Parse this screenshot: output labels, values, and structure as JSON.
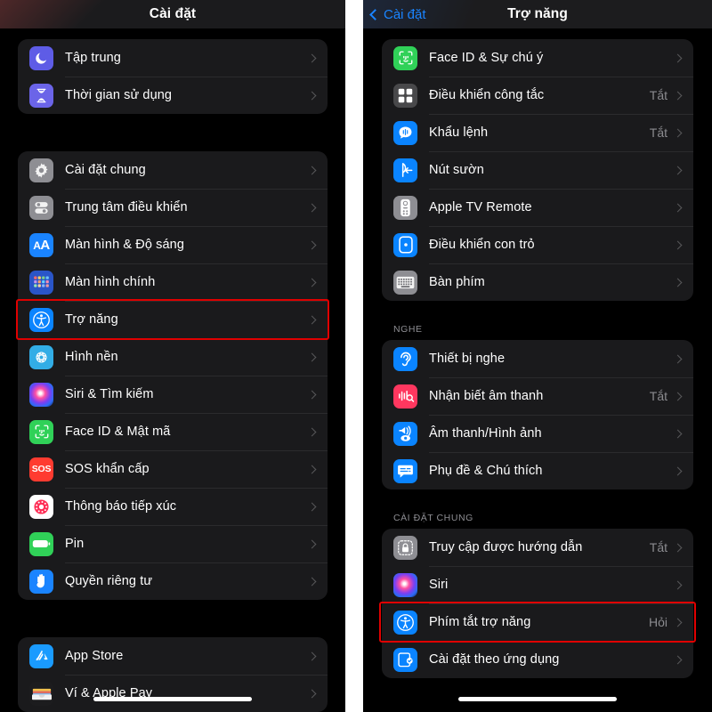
{
  "left_panel": {
    "nav": {
      "title": "Cài đặt"
    },
    "groups": [
      {
        "rows": [
          {
            "label": "Tập trung",
            "value": "",
            "icon": "moon-icon",
            "icon_bg": "#5e5ce6"
          },
          {
            "label": "Thời gian sử dụng",
            "value": "",
            "icon": "hourglass-icon",
            "icon_bg": "#6b64e8"
          }
        ]
      },
      {
        "rows": [
          {
            "label": "Cài đặt chung",
            "value": "",
            "icon": "gear-icon",
            "icon_bg": "#8e8e93"
          },
          {
            "label": "Trung tâm điều khiển",
            "value": "",
            "icon": "control-center-icon",
            "icon_bg": "#8e8e93"
          },
          {
            "label": "Màn hình & Độ sáng",
            "value": "",
            "icon": "display-brightness-icon",
            "icon_bg": "#1a84ff"
          },
          {
            "label": "Màn hình chính",
            "value": "",
            "icon": "home-screen-icon",
            "icon_bg": "#2a55c8"
          },
          {
            "label": "Trợ năng",
            "value": "",
            "icon": "accessibility-icon",
            "icon_bg": "#0a84ff",
            "highlighted": true
          },
          {
            "label": "Hình nền",
            "value": "",
            "icon": "wallpaper-icon",
            "icon_bg": "#32ade6"
          },
          {
            "label": "Siri & Tìm kiếm",
            "value": "",
            "icon": "siri-icon",
            "icon_bg": "#2a2a2e"
          },
          {
            "label": "Face ID & Mật mã",
            "value": "",
            "icon": "face-id-icon",
            "icon_bg": "#30d158"
          },
          {
            "label": "SOS khẩn cấp",
            "value": "",
            "icon": "sos-icon",
            "icon_bg": "#ff3b30"
          },
          {
            "label": "Thông báo tiếp xúc",
            "value": "",
            "icon": "exposure-notification-icon",
            "icon_bg": "#ffffff"
          },
          {
            "label": "Pin",
            "value": "",
            "icon": "battery-icon",
            "icon_bg": "#30d158"
          },
          {
            "label": "Quyền riêng tư",
            "value": "",
            "icon": "privacy-hand-icon",
            "icon_bg": "#1a84ff"
          }
        ]
      },
      {
        "rows": [
          {
            "label": "App Store",
            "value": "",
            "icon": "app-store-icon",
            "icon_bg": "#1a9bff"
          },
          {
            "label": "Ví & Apple Pay",
            "value": "",
            "icon": "wallet-icon",
            "icon_bg": "#1c1c1e"
          }
        ]
      }
    ]
  },
  "right_panel": {
    "nav": {
      "back_label": "Cài đặt",
      "title": "Trợ năng"
    },
    "sections": [
      {
        "header": "",
        "rows": [
          {
            "label": "Face ID & Sự chú ý",
            "value": "",
            "icon": "face-id-icon",
            "icon_bg": "#30d158"
          },
          {
            "label": "Điều khiển công tắc",
            "value": "Tắt",
            "icon": "switch-control-icon",
            "icon_bg": "#48484a"
          },
          {
            "label": "Khẩu lệnh",
            "value": "Tắt",
            "icon": "voice-control-icon",
            "icon_bg": "#0a84ff"
          },
          {
            "label": "Nút sườn",
            "value": "",
            "icon": "side-button-icon",
            "icon_bg": "#0a84ff"
          },
          {
            "label": "Apple TV Remote",
            "value": "",
            "icon": "apple-tv-remote-icon",
            "icon_bg": "#8e8e93"
          },
          {
            "label": "Điều khiển con trỏ",
            "value": "",
            "icon": "pointer-control-icon",
            "icon_bg": "#0a84ff"
          },
          {
            "label": "Bàn phím",
            "value": "",
            "icon": "keyboard-icon",
            "icon_bg": "#8e8e93"
          }
        ]
      },
      {
        "header": "NGHE",
        "rows": [
          {
            "label": "Thiết bị nghe",
            "value": "",
            "icon": "hearing-device-icon",
            "icon_bg": "#0a84ff"
          },
          {
            "label": "Nhận biết âm thanh",
            "value": "Tắt",
            "icon": "sound-recognition-icon",
            "icon_bg": "#ff375f"
          },
          {
            "label": "Âm thanh/Hình ảnh",
            "value": "",
            "icon": "audio-visual-icon",
            "icon_bg": "#0a84ff"
          },
          {
            "label": "Phụ đề & Chú thích",
            "value": "",
            "icon": "subtitles-icon",
            "icon_bg": "#0a84ff"
          }
        ]
      },
      {
        "header": "CÀI ĐẶT CHUNG",
        "rows": [
          {
            "label": "Truy cập được hướng dẫn",
            "value": "Tắt",
            "icon": "guided-access-lock-icon",
            "icon_bg": "#8e8e93"
          },
          {
            "label": "Siri",
            "value": "",
            "icon": "siri-icon",
            "icon_bg": "#2a2a2e"
          },
          {
            "label": "Phím tắt trợ năng",
            "value": "Hỏi",
            "icon": "accessibility-icon",
            "icon_bg": "#0a84ff",
            "highlighted": true
          },
          {
            "label": "Cài đặt theo ứng dụng",
            "value": "",
            "icon": "per-app-settings-icon",
            "icon_bg": "#0a84ff"
          }
        ]
      }
    ]
  },
  "colors": {
    "highlight_border": "#e00000",
    "accent_blue": "#1a84ff",
    "card_bg": "#1a1a1c",
    "page_bg": "#000000"
  }
}
